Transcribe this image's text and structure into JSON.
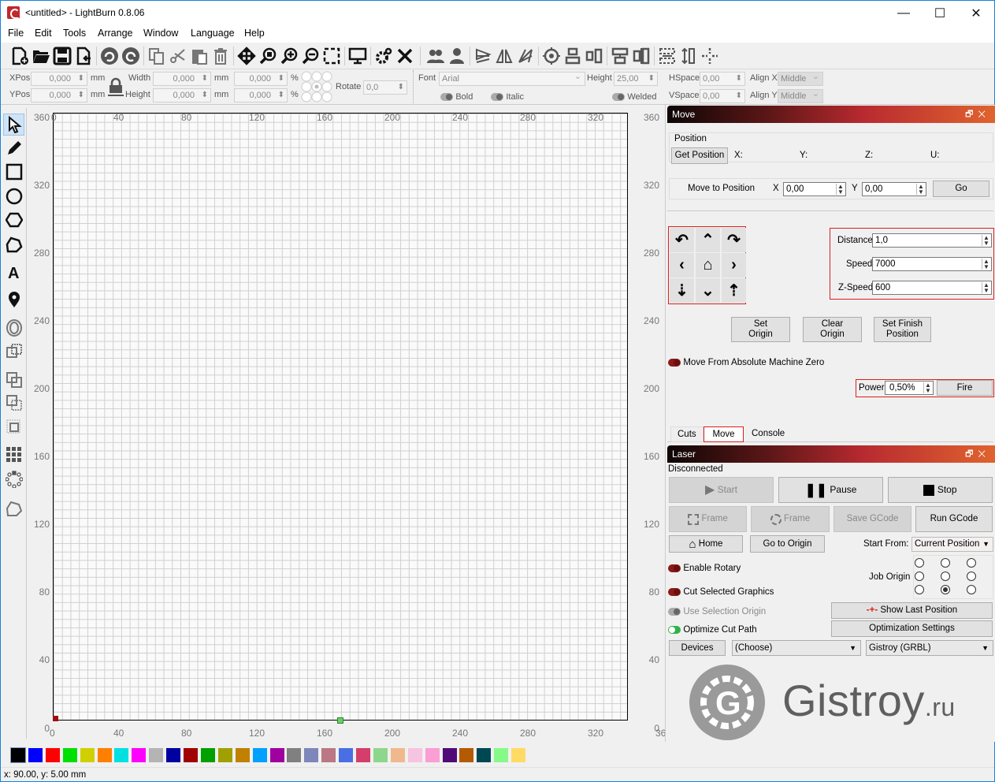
{
  "window": {
    "title": "<untitled> - LightBurn 0.8.06",
    "min_icon": "minimize-icon",
    "max_icon": "maximize-icon",
    "close_icon": "close-icon"
  },
  "menu": [
    "File",
    "Edit",
    "Tools",
    "Arrange",
    "Window",
    "Language",
    "Help"
  ],
  "toolbar": {
    "icons": [
      "new-file-icon",
      "open-folder-icon",
      "save-icon",
      "import-icon",
      "undo-icon",
      "redo-icon",
      "copy-icon",
      "cut-icon",
      "paste-icon",
      "delete-icon",
      "move-icon",
      "zoom-page-icon",
      "zoom-in-icon",
      "zoom-out-icon",
      "frame-selection-icon",
      "device-settings-icon",
      "gear-icon",
      "tools-icon",
      "group-icon",
      "ungroup-icon",
      "mirror-h-icon",
      "mirror-v-icon",
      "rotate-icon",
      "center-icon",
      "align-left-icon",
      "align-right-icon",
      "align-top-icon",
      "align-middle-icon",
      "distribute-h-icon",
      "distribute-v-icon",
      "resize-icon",
      "move-to-icon"
    ]
  },
  "props": {
    "xpos_label": "XPos",
    "xpos": "0,000",
    "ypos_label": "YPos",
    "ypos": "0,000",
    "unit": "mm",
    "width_label": "Width",
    "width": "0,000",
    "height_label": "Height",
    "height": "0,000",
    "wpct": "0,000",
    "hpct": "0,000",
    "pct": "%",
    "rotate_label": "Rotate",
    "rotate": "0,0",
    "font_label": "Font",
    "font": "Arial",
    "fheight_label": "Height",
    "fheight": "25,00",
    "hspace_label": "HSpace",
    "hspace": "0,00",
    "vspace_label": "VSpace",
    "vspace": "0,00",
    "alignx_label": "Align X",
    "alignx": "Middle",
    "aligny_label": "Align Y",
    "aligny": "Middle",
    "bold": "Bold",
    "italic": "Italic",
    "welded": "Welded"
  },
  "tools": [
    "select-icon",
    "pencil-icon",
    "rectangle-icon",
    "ellipse-icon",
    "polygon-icon",
    "pen-polygon-icon",
    "text-icon",
    "position-pin-icon",
    "offset-icon",
    "boolean-union-icon",
    "boolean-subtract-icon",
    "boolean-intersect-icon",
    "weld-icon",
    "grid-array-icon",
    "circular-array-icon",
    "node-edit-icon"
  ],
  "canvas": {
    "x_ticks": [
      "0",
      "40",
      "80",
      "120",
      "160",
      "200",
      "240",
      "280",
      "320",
      "36"
    ],
    "y_ticks": [
      "360",
      "320",
      "280",
      "240",
      "200",
      "160",
      "120",
      "80",
      "40",
      "0"
    ],
    "y_ticks_right": [
      "360",
      "320",
      "280",
      "240",
      "200",
      "160",
      "120",
      "80",
      "40",
      "0"
    ]
  },
  "move_panel": {
    "title": "Move",
    "position_label": "Position",
    "get_position": "Get Position",
    "x_lbl": "X:",
    "y_lbl": "Y:",
    "z_lbl": "Z:",
    "u_lbl": "U:",
    "move_to_position": "Move to Position",
    "x": "X",
    "x_val": "0,00",
    "y": "Y",
    "y_val": "0,00",
    "go": "Go",
    "distance_label": "Distance",
    "distance": "1,0",
    "speed_label": "Speed",
    "speed": "7000",
    "zspeed_label": "Z-Speed",
    "zspeed": "600",
    "set_origin": "Set\nOrigin",
    "clear_origin": "Clear\nOrigin",
    "set_finish": "Set Finish\nPosition",
    "abs_zero": "Move From Absolute Machine Zero",
    "power_label": "Power",
    "power": "0,50%",
    "fire": "Fire"
  },
  "tabs": [
    "Cuts",
    "Move",
    "Console"
  ],
  "active_tab": "Move",
  "laser_panel": {
    "title": "Laser",
    "status": "Disconnected",
    "start": "Start",
    "pause": "Pause",
    "stop": "Stop",
    "frame1": "Frame",
    "frame2": "Frame",
    "save_gcode": "Save GCode",
    "run_gcode": "Run GCode",
    "home": "Home",
    "go_origin": "Go to Origin",
    "start_from_label": "Start From:",
    "start_from": "Current Position",
    "enable_rotary": "Enable Rotary",
    "cut_selected": "Cut Selected Graphics",
    "use_sel_origin": "Use Selection Origin",
    "optimize": "Optimize Cut Path",
    "job_origin_label": "Job Origin",
    "job_origin_selected": "bottom-center",
    "show_last": "Show Last Position",
    "opt_settings": "Optimization Settings",
    "devices": "Devices",
    "choose": "(Choose)",
    "device": "Gistroy (GRBL)"
  },
  "watermark": {
    "main": "Gistroy",
    "suffix": ".ru"
  },
  "palette": [
    "#000000",
    "#0000ff",
    "#ff0000",
    "#00e000",
    "#d0d000",
    "#ff8000",
    "#00e0e0",
    "#ff00ff",
    "#b4b4b4",
    "#0000a0",
    "#a00000",
    "#00a000",
    "#a0a000",
    "#c08000",
    "#00a0ff",
    "#a000a0",
    "#808080",
    "#7d87b9",
    "#bb7784",
    "#4a6fe3",
    "#d33f6a",
    "#8cd78c",
    "#f0b98d",
    "#f6c4e1",
    "#fa9ed4",
    "#500a78",
    "#b45a00",
    "#004754",
    "#86fa88",
    "#ffdb66"
  ],
  "status_bar": "x: 90.00, y: 5.00 mm"
}
